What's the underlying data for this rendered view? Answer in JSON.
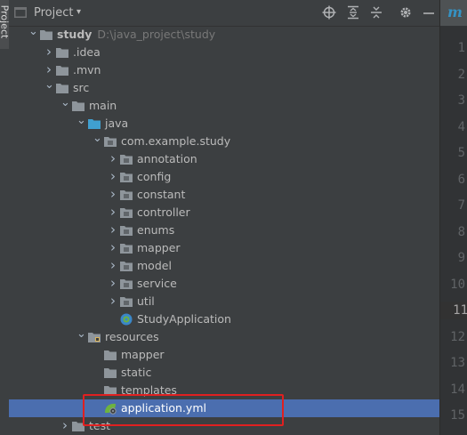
{
  "side_tab": {
    "label": "Project"
  },
  "header": {
    "title": "Project",
    "dropdown_glyph": "▾"
  },
  "toolbar": [
    {
      "icon": "crosshair-icon",
      "glyph": "⊕"
    },
    {
      "icon": "expand-all-icon",
      "glyph": "⇕"
    },
    {
      "icon": "collapse-all-icon",
      "glyph": "⇳"
    },
    {
      "icon": "gear-icon",
      "glyph": "⚙"
    },
    {
      "icon": "minimize-icon",
      "glyph": "—"
    }
  ],
  "editor": {
    "tab_letter": "m",
    "line_numbers": [
      "1",
      "2",
      "3",
      "4",
      "5",
      "6",
      "7",
      "8",
      "9",
      "10",
      "11",
      "12",
      "13",
      "14",
      "15"
    ],
    "current_line": "11"
  },
  "tree": [
    {
      "label": "study",
      "path": "D:\\java_project\\study",
      "depth": 0,
      "arrow": "open",
      "icon": "folder",
      "bold": true
    },
    {
      "label": ".idea",
      "depth": 1,
      "arrow": "closed",
      "icon": "folder"
    },
    {
      "label": ".mvn",
      "depth": 1,
      "arrow": "closed",
      "icon": "folder"
    },
    {
      "label": "src",
      "depth": 1,
      "arrow": "open",
      "icon": "folder"
    },
    {
      "label": "main",
      "depth": 2,
      "arrow": "open",
      "icon": "folder"
    },
    {
      "label": "java",
      "depth": 3,
      "arrow": "open",
      "icon": "folder-blue"
    },
    {
      "label": "com.example.study",
      "depth": 4,
      "arrow": "open",
      "icon": "package"
    },
    {
      "label": "annotation",
      "depth": 5,
      "arrow": "closed",
      "icon": "package"
    },
    {
      "label": "config",
      "depth": 5,
      "arrow": "closed",
      "icon": "package"
    },
    {
      "label": "constant",
      "depth": 5,
      "arrow": "closed",
      "icon": "package"
    },
    {
      "label": "controller",
      "depth": 5,
      "arrow": "closed",
      "icon": "package"
    },
    {
      "label": "enums",
      "depth": 5,
      "arrow": "closed",
      "icon": "package"
    },
    {
      "label": "mapper",
      "depth": 5,
      "arrow": "closed",
      "icon": "package"
    },
    {
      "label": "model",
      "depth": 5,
      "arrow": "closed",
      "icon": "package"
    },
    {
      "label": "service",
      "depth": 5,
      "arrow": "closed",
      "icon": "package"
    },
    {
      "label": "util",
      "depth": 5,
      "arrow": "closed",
      "icon": "package"
    },
    {
      "label": "StudyApplication",
      "depth": 5,
      "arrow": "none",
      "icon": "spring-class"
    },
    {
      "label": "resources",
      "depth": 3,
      "arrow": "open",
      "icon": "folder-res"
    },
    {
      "label": "mapper",
      "depth": 4,
      "arrow": "none",
      "icon": "folder"
    },
    {
      "label": "static",
      "depth": 4,
      "arrow": "none",
      "icon": "folder"
    },
    {
      "label": "templates",
      "depth": 4,
      "arrow": "none",
      "icon": "folder"
    },
    {
      "label": "application.yml",
      "depth": 4,
      "arrow": "none",
      "icon": "spring-yml",
      "selected": true
    },
    {
      "label": "test",
      "depth": 2,
      "arrow": "closed",
      "icon": "folder"
    }
  ],
  "colors": {
    "panel_bg": "#3c3f41",
    "selection": "#4b6eaf",
    "highlight_box": "#e02020",
    "folder": "#8e959b",
    "source_folder": "#40a0d0",
    "spring_green": "#6db33f"
  }
}
